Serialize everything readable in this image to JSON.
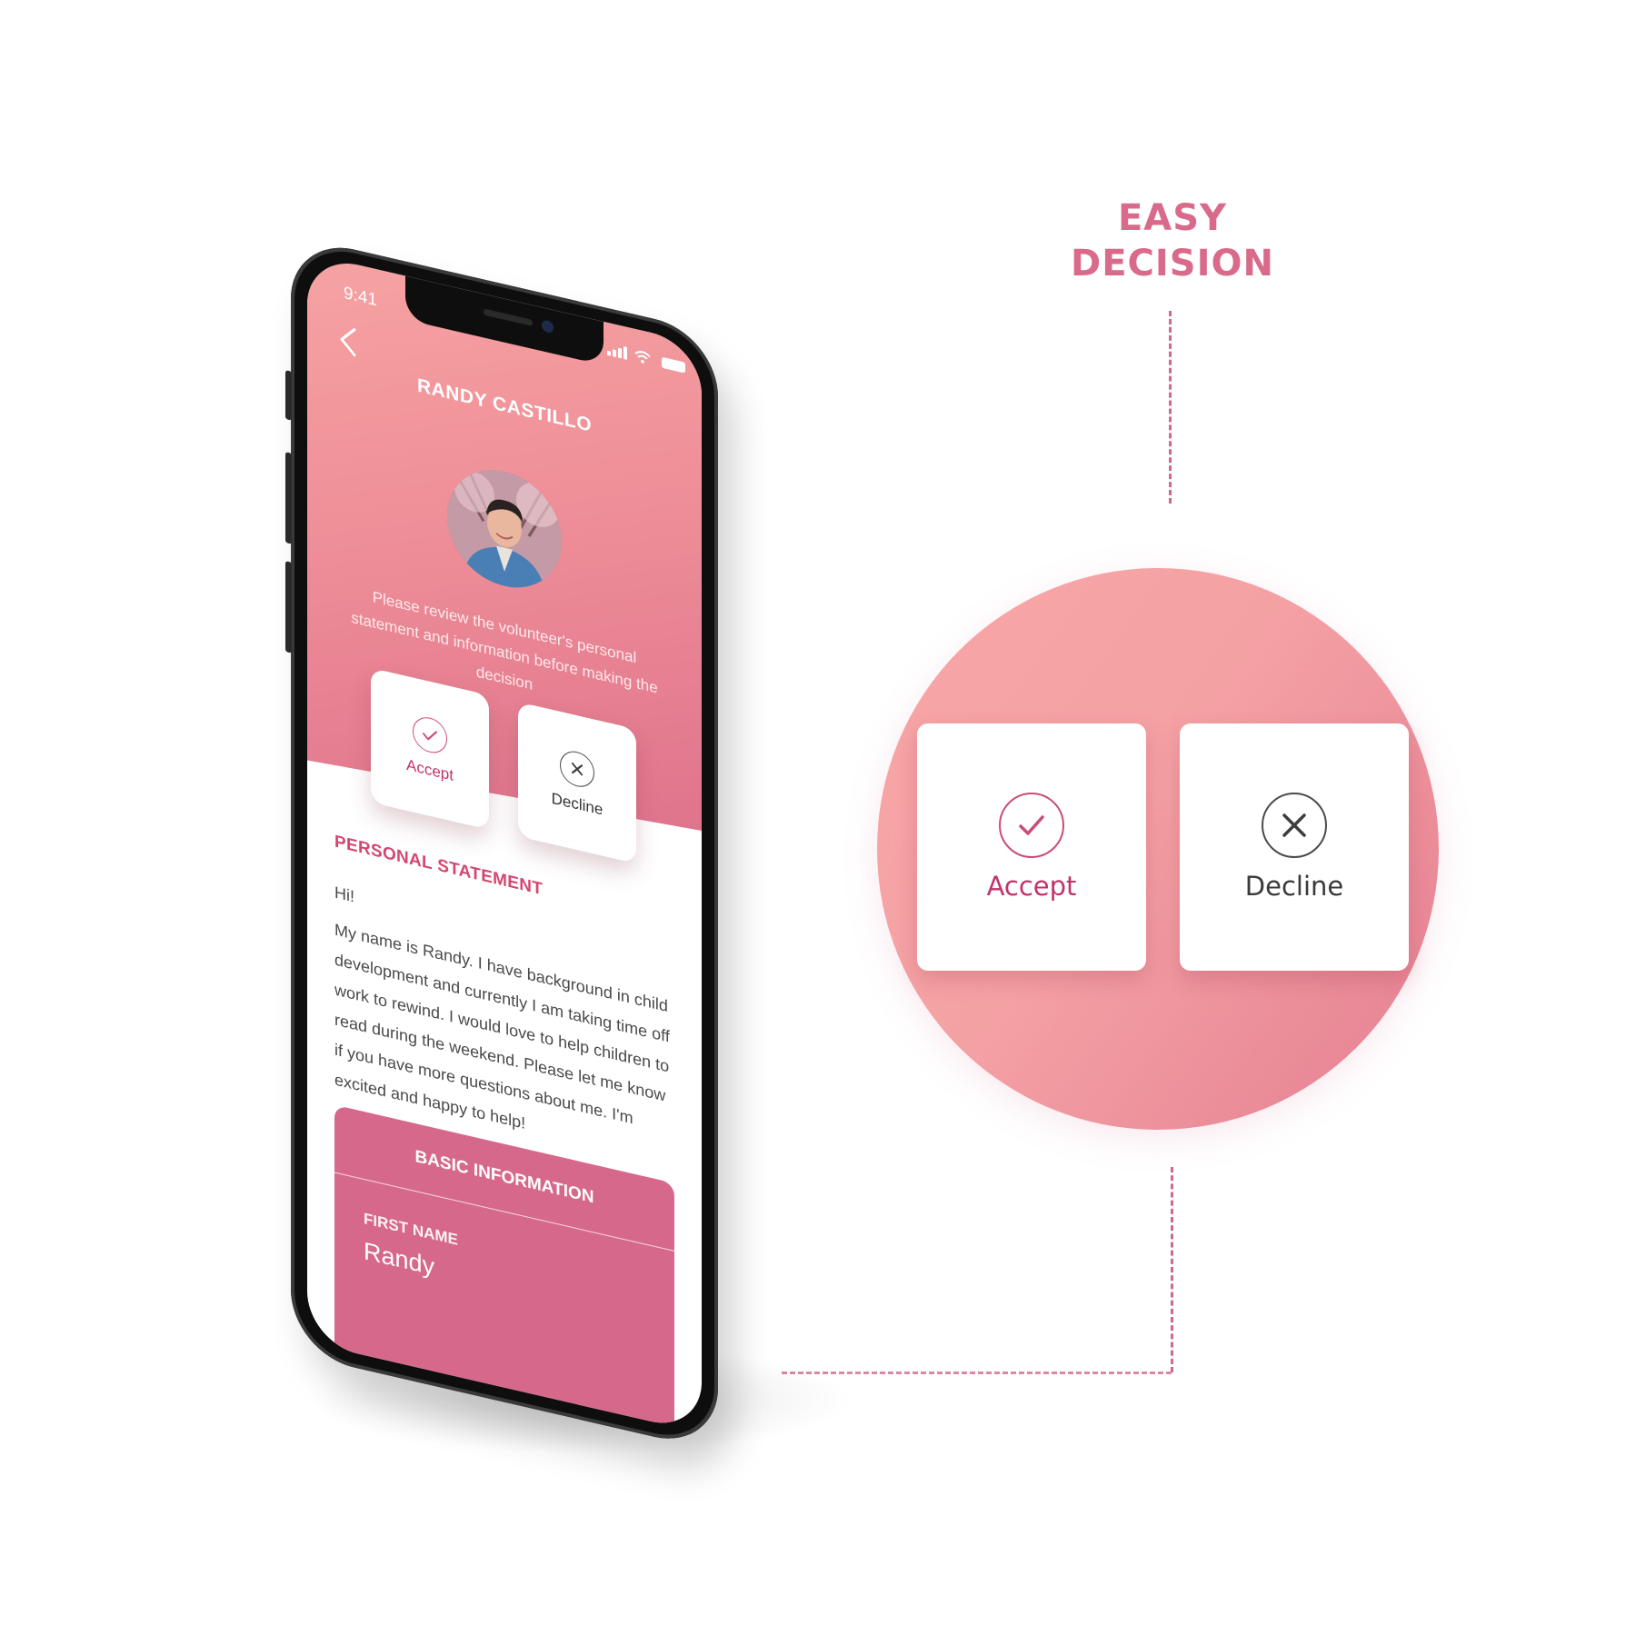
{
  "headline": {
    "line1": "EASY",
    "line2": "DECISION",
    "color": "#d96a8a"
  },
  "zoom": {
    "accept_label": "Accept",
    "decline_label": "Decline",
    "accept_icon": "check-circle-icon",
    "decline_icon": "x-circle-icon"
  },
  "phone": {
    "status_bar": {
      "time": "9:41",
      "icons": [
        "signal-icon",
        "wifi-icon",
        "battery-icon"
      ]
    },
    "header": {
      "back_icon": "chevron-left-icon",
      "title": "RANDY CASTILLO",
      "instructions": "Please review the volunteer's personal statement and information before making the decision"
    },
    "actions": {
      "accept_label": "Accept",
      "decline_label": "Decline"
    },
    "personal_statement": {
      "heading": "PERSONAL STATEMENT",
      "greeting": "Hi!",
      "body": "My name is Randy. I have background in child development and currently I am taking time off work to rewind. I would love to help children to read during the weekend. Please let me know if you have more questions about me. I'm excited and happy to help!"
    },
    "basic_information": {
      "heading": "BASIC INFORMATION",
      "first_name_label": "FIRST NAME",
      "first_name_value": "Randy"
    }
  },
  "colors": {
    "brand_pink": "#d6698b",
    "accent_magenta": "#c2336b",
    "header_gradient_start": "#f6a3a3",
    "header_gradient_end": "#dc6f8b"
  }
}
